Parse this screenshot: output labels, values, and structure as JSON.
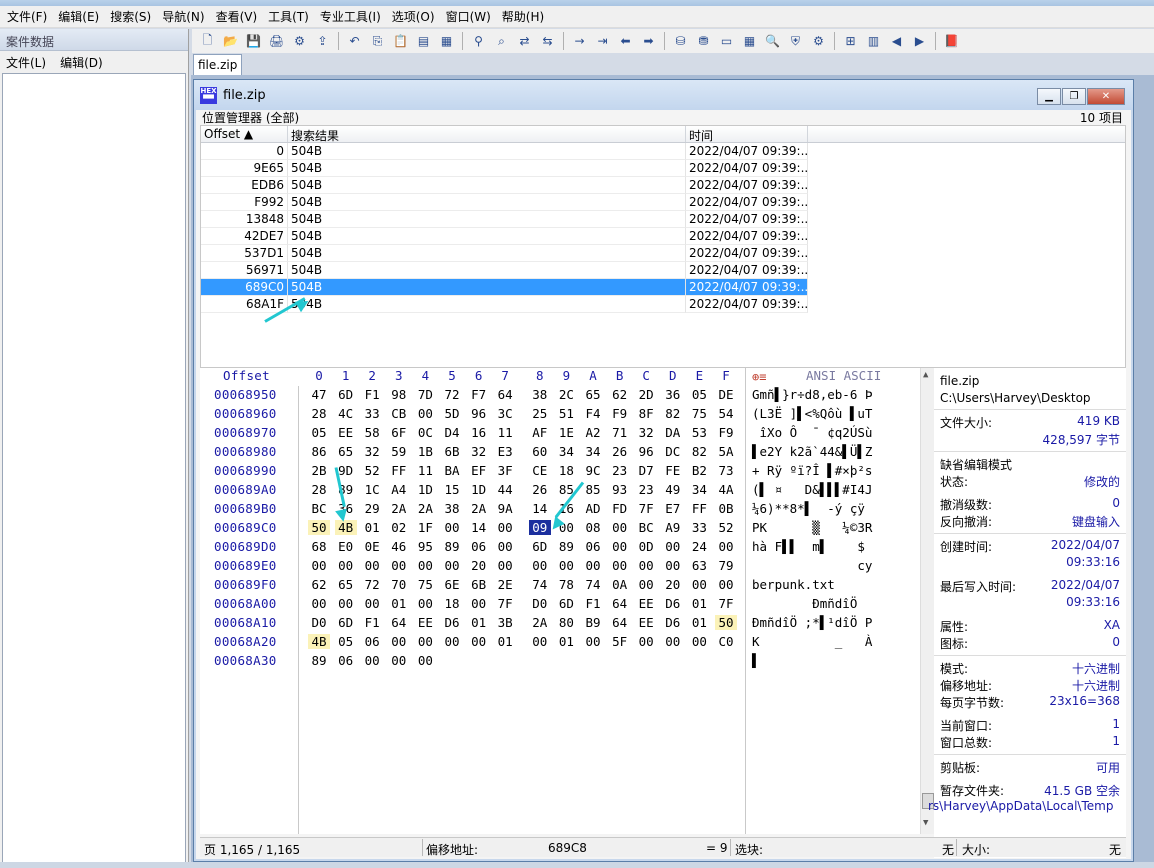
{
  "menu": [
    "文件(F)",
    "编辑(E)",
    "搜索(S)",
    "导航(N)",
    "查看(V)",
    "工具(T)",
    "专业工具(I)",
    "选项(O)",
    "窗口(W)",
    "帮助(H)"
  ],
  "left_panel": {
    "title": "案件数据",
    "menu": [
      "文件(L)",
      "编辑(D)"
    ]
  },
  "toolbar_icons": [
    "new-file-icon",
    "open-icon",
    "save-icon",
    "print-icon",
    "properties-icon",
    "export-icon",
    "sep",
    "undo-icon",
    "copy-icon",
    "paste-icon",
    "clipboard-icon",
    "copy-hex-icon",
    "sep",
    "find-icon",
    "find-hex-icon",
    "replace-icon",
    "replace-hex-icon",
    "sep",
    "goto-icon",
    "goto-offset-icon",
    "back-icon",
    "forward-icon",
    "sep",
    "disk-icon",
    "open-disk-icon",
    "ram-icon",
    "calculator-icon",
    "magnify-icon",
    "shield-icon",
    "gear-icon",
    "sep",
    "tiles-icon",
    "book-icon",
    "left-icon",
    "right-icon",
    "sep",
    "bookmark-icon"
  ],
  "doc_tab": "file.zip",
  "window": {
    "title": "file.zip",
    "hex_logo": "HEX",
    "position_manager": "位置管理器 (全部)",
    "item_count": "10 项目",
    "columns": [
      "Offset",
      "搜索结果",
      "时间"
    ],
    "rows": [
      {
        "offset": "0",
        "result": "504B",
        "time": "2022/04/07   09:39:..."
      },
      {
        "offset": "9E65",
        "result": "504B",
        "time": "2022/04/07   09:39:..."
      },
      {
        "offset": "EDB6",
        "result": "504B",
        "time": "2022/04/07   09:39:..."
      },
      {
        "offset": "F992",
        "result": "504B",
        "time": "2022/04/07   09:39:..."
      },
      {
        "offset": "13848",
        "result": "504B",
        "time": "2022/04/07   09:39:..."
      },
      {
        "offset": "42DE7",
        "result": "504B",
        "time": "2022/04/07   09:39:..."
      },
      {
        "offset": "537D1",
        "result": "504B",
        "time": "2022/04/07   09:39:..."
      },
      {
        "offset": "56971",
        "result": "504B",
        "time": "2022/04/07   09:39:..."
      },
      {
        "offset": "689C0",
        "result": "504B",
        "time": "2022/04/07   09:39:...",
        "selected": true
      },
      {
        "offset": "68A1F",
        "result": "504B",
        "time": "2022/04/07   09:39:..."
      }
    ]
  },
  "hex": {
    "offset_label": "Offset",
    "columns": [
      "0",
      "1",
      "2",
      "3",
      "4",
      "5",
      "6",
      "7",
      "8",
      "9",
      "A",
      "B",
      "C",
      "D",
      "E",
      "F"
    ],
    "ansi_label": "ANSI ASCII",
    "rows": [
      {
        "offset": "00068950",
        "bytes": [
          "47",
          "6D",
          "F1",
          "98",
          "7D",
          "72",
          "F7",
          "64",
          "38",
          "2C",
          "65",
          "62",
          "2D",
          "36",
          "05",
          "DE"
        ],
        "ascii": "Gmñ▌}r÷d8,eb-6 Þ"
      },
      {
        "offset": "00068960",
        "bytes": [
          "28",
          "4C",
          "33",
          "CB",
          "00",
          "5D",
          "96",
          "3C",
          "25",
          "51",
          "F4",
          "F9",
          "8F",
          "82",
          "75",
          "54"
        ],
        "ascii": "(L3Ë ]▌<%Qôù ▌uT"
      },
      {
        "offset": "00068970",
        "bytes": [
          "05",
          "EE",
          "58",
          "6F",
          "0C",
          "D4",
          "16",
          "11",
          "AF",
          "1E",
          "A2",
          "71",
          "32",
          "DA",
          "53",
          "F9"
        ],
        "ascii": " îXo Ô  ¯ ¢q2ÚSù"
      },
      {
        "offset": "00068980",
        "bytes": [
          "86",
          "65",
          "32",
          "59",
          "1B",
          "6B",
          "32",
          "E3",
          "60",
          "34",
          "34",
          "26",
          "96",
          "DC",
          "82",
          "5A"
        ],
        "ascii": "▌e2Y k2ã`44&▌Ü▌Z"
      },
      {
        "offset": "00068990",
        "bytes": [
          "2B",
          "9D",
          "52",
          "FF",
          "11",
          "BA",
          "EF",
          "3F",
          "CE",
          "18",
          "9C",
          "23",
          "D7",
          "FE",
          "B2",
          "73"
        ],
        "ascii": "+ Rÿ ºï?Î ▌#×þ²s"
      },
      {
        "offset": "000689A0",
        "bytes": [
          "28",
          "89",
          "1C",
          "A4",
          "1D",
          "15",
          "1D",
          "44",
          "26",
          "85",
          "85",
          "93",
          "23",
          "49",
          "34",
          "4A"
        ],
        "ascii": "(▌ ¤   D&▌▌▌#I4J"
      },
      {
        "offset": "000689B0",
        "bytes": [
          "BC",
          "36",
          "29",
          "2A",
          "2A",
          "38",
          "2A",
          "9A",
          "14",
          "16",
          "AD",
          "FD",
          "7F",
          "E7",
          "FF",
          "0B"
        ],
        "ascii": "¼6)**8*▌  -ý çÿ "
      },
      {
        "offset": "000689C0",
        "bytes": [
          "50",
          "4B",
          "01",
          "02",
          "1F",
          "00",
          "14",
          "00",
          "09",
          "00",
          "08",
          "00",
          "BC",
          "A9",
          "33",
          "52"
        ],
        "ascii": "PK      ▒   ¼©3R"
      },
      {
        "offset": "000689D0",
        "bytes": [
          "68",
          "E0",
          "0E",
          "46",
          "95",
          "89",
          "06",
          "00",
          "6D",
          "89",
          "06",
          "00",
          "0D",
          "00",
          "24",
          "00"
        ],
        "ascii": "hà F▌▌  m▌    $ "
      },
      {
        "offset": "000689E0",
        "bytes": [
          "00",
          "00",
          "00",
          "00",
          "00",
          "00",
          "20",
          "00",
          "00",
          "00",
          "00",
          "00",
          "00",
          "00",
          "63",
          "79"
        ],
        "ascii": "              cy"
      },
      {
        "offset": "000689F0",
        "bytes": [
          "62",
          "65",
          "72",
          "70",
          "75",
          "6E",
          "6B",
          "2E",
          "74",
          "78",
          "74",
          "0A",
          "00",
          "20",
          "00",
          "00"
        ],
        "ascii": "berpunk.txt     "
      },
      {
        "offset": "00068A00",
        "bytes": [
          "00",
          "00",
          "00",
          "01",
          "00",
          "18",
          "00",
          "7F",
          "D0",
          "6D",
          "F1",
          "64",
          "EE",
          "D6",
          "01",
          "7F"
        ],
        "ascii": "        ÐmñdîÖ  "
      },
      {
        "offset": "00068A10",
        "bytes": [
          "D0",
          "6D",
          "F1",
          "64",
          "EE",
          "D6",
          "01",
          "3B",
          "2A",
          "80",
          "B9",
          "64",
          "EE",
          "D6",
          "01",
          "50"
        ],
        "ascii": "ÐmñdîÖ ;*▌¹dîÖ P"
      },
      {
        "offset": "00068A20",
        "bytes": [
          "4B",
          "05",
          "06",
          "00",
          "00",
          "00",
          "00",
          "01",
          "00",
          "01",
          "00",
          "5F",
          "00",
          "00",
          "00",
          "C0"
        ],
        "ascii": "K          _   À"
      },
      {
        "offset": "00068A30",
        "bytes": [
          "89",
          "06",
          "00",
          "00",
          "00"
        ],
        "ascii": "▌"
      }
    ]
  },
  "info": {
    "file_name": "file.zip",
    "path": "C:\\Users\\Harvey\\Desktop",
    "size_label": "文件大小:",
    "size_kb": "419 KB",
    "size_bytes": "428,597 字节",
    "edit_mode_label": "缺省编辑模式",
    "state_label": "状态:",
    "state_value": "修改的",
    "undo_level_label": "撤消级数:",
    "undo_level_value": "0",
    "redo_label": "反向撤消:",
    "redo_value": "键盘输入",
    "created_label": "创建时间:",
    "created_date": "2022/04/07",
    "created_time": "09:33:16",
    "modified_label": "最后写入时间:",
    "modified_date": "2022/04/07",
    "modified_time": "09:33:16",
    "attr_label": "属性:",
    "attr_value": "XA",
    "icon_label": "图标:",
    "icon_value": "0",
    "mode_label": "模式:",
    "mode_value": "十六进制",
    "offset_addr_label": "偏移地址:",
    "offset_addr_value": "十六进制",
    "bytes_per_page_label": "每页字节数:",
    "bytes_per_page_value": "23x16=368",
    "current_window_label": "当前窗口:",
    "current_window_value": "1",
    "window_total_label": "窗口总数:",
    "window_total_value": "1",
    "clipboard_label": "剪贴板:",
    "clipboard_value": "可用",
    "temp_label": "暂存文件夹:",
    "temp_value": "41.5 GB 空余",
    "temp_path": "rs\\Harvey\\AppData\\Local\\Temp"
  },
  "status": {
    "page": "页 1,165 / 1,165",
    "offset_label": "偏移地址:",
    "offset_value": "689C8",
    "equals": "= 9",
    "selection_label": "选块:",
    "none": "无",
    "size_label": "大小:",
    "size_value": "无"
  },
  "colors": {
    "selection": "#3399ff",
    "highlight": "#fbf2b8",
    "offset_text": "#1a1aa6",
    "arrow": "#22c7d0"
  }
}
